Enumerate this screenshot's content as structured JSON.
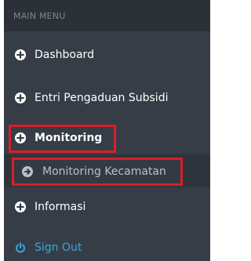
{
  "menu": {
    "header": "MAIN MENU",
    "items": [
      {
        "label": "Dashboard",
        "icon": "plus-circle-icon"
      },
      {
        "label": "Entri Pengaduan Subsidi",
        "icon": "plus-circle-icon"
      },
      {
        "label": "Monitoring",
        "icon": "plus-circle-icon"
      },
      {
        "label": "Informasi",
        "icon": "plus-circle-icon"
      },
      {
        "label": "Sign Out",
        "icon": "power-icon"
      }
    ],
    "submenu": {
      "label": "Monitoring Kecamatan",
      "icon": "arrow-circle-right-icon"
    }
  },
  "colors": {
    "sidebar_bg": "#373d46",
    "header_bg": "#2c3138",
    "highlight": "#d61f28",
    "signout": "#36a8e0"
  }
}
